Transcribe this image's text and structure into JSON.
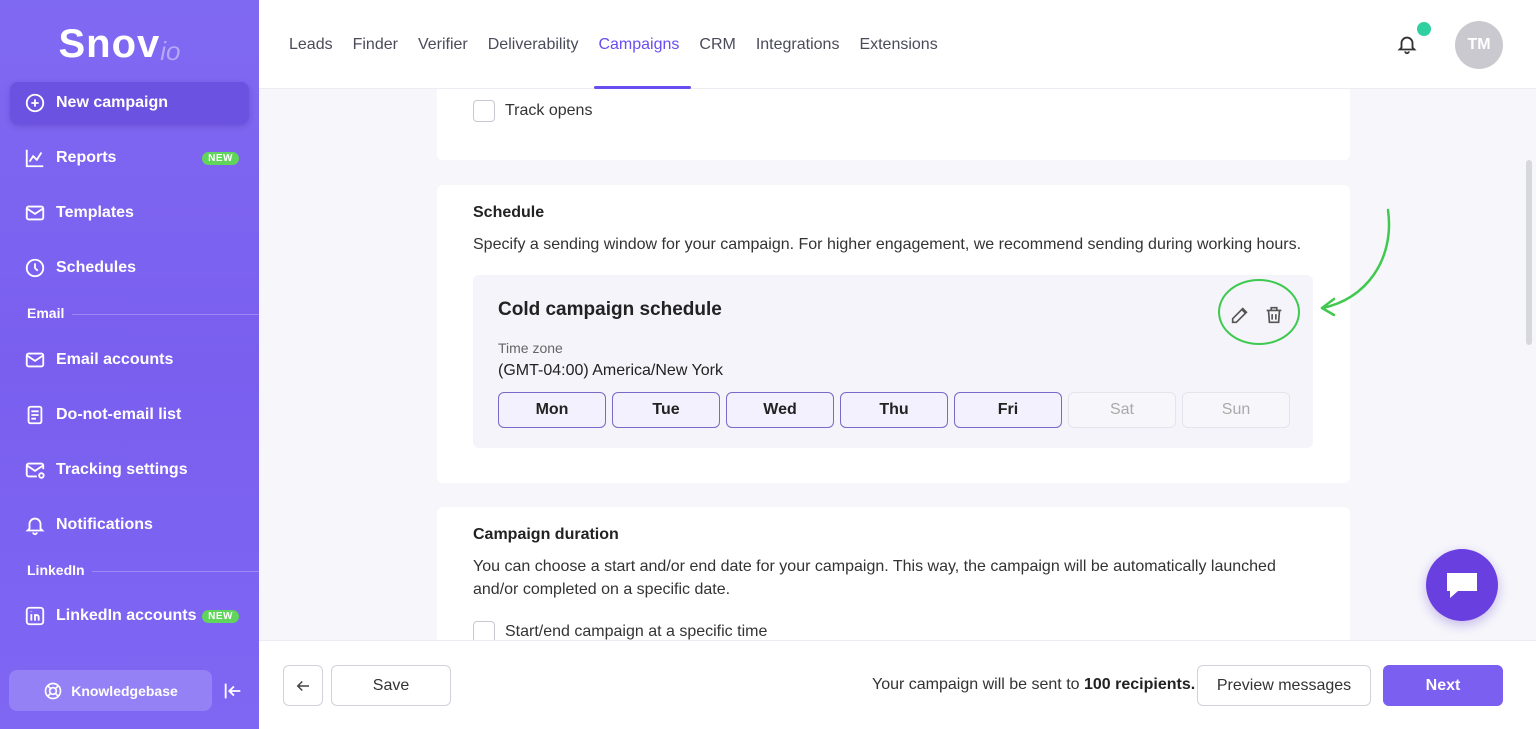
{
  "logo": {
    "main": "Snov",
    "suffix": "io"
  },
  "sidebar": {
    "items": [
      {
        "label": "New campaign",
        "icon": "plus-circle-icon"
      },
      {
        "label": "Reports",
        "icon": "chart-icon",
        "badge": "NEW"
      },
      {
        "label": "Templates",
        "icon": "template-mail-icon"
      },
      {
        "label": "Schedules",
        "icon": "clock-icon"
      },
      {
        "label": "Email accounts",
        "icon": "mail-icon"
      },
      {
        "label": "Do-not-email list",
        "icon": "list-doc-icon"
      },
      {
        "label": "Tracking settings",
        "icon": "mail-settings-icon"
      },
      {
        "label": "Notifications",
        "icon": "bell-icon"
      },
      {
        "label": "LinkedIn accounts",
        "icon": "linkedin-icon",
        "badge": "NEW"
      }
    ],
    "sections": {
      "email": "Email",
      "linkedin": "LinkedIn"
    },
    "knowledgebase": "Knowledgebase"
  },
  "topnav": {
    "items": [
      "Leads",
      "Finder",
      "Verifier",
      "Deliverability",
      "Campaigns",
      "CRM",
      "Integrations",
      "Extensions"
    ],
    "active": "Campaigns",
    "avatar_initials": "TM"
  },
  "tracking": {
    "track_opens_label": "Track opens"
  },
  "schedule": {
    "title": "Schedule",
    "description": "Specify a sending window for your campaign. For higher engagement, we recommend sending during working hours.",
    "schedule_name": "Cold campaign schedule",
    "timezone_label": "Time zone",
    "timezone_value": "(GMT-04:00) America/New York",
    "days": [
      {
        "label": "Mon",
        "active": true
      },
      {
        "label": "Tue",
        "active": true
      },
      {
        "label": "Wed",
        "active": true
      },
      {
        "label": "Thu",
        "active": true
      },
      {
        "label": "Fri",
        "active": true
      },
      {
        "label": "Sat",
        "active": false
      },
      {
        "label": "Sun",
        "active": false
      }
    ]
  },
  "duration": {
    "title": "Campaign duration",
    "description": "You can choose a start and/or end date for your campaign. This way, the campaign will be automatically launched and/or completed on a specific date.",
    "checkbox_label": "Start/end campaign at a specific time"
  },
  "footer": {
    "save_label": "Save",
    "send_prefix": "Your campaign will be sent to ",
    "send_count": "100 recipients.",
    "preview_label": "Preview messages",
    "next_label": "Next"
  },
  "colors": {
    "accent": "#7a5ff0",
    "highlight": "#3fc94f",
    "badge": "#5fd55b"
  }
}
